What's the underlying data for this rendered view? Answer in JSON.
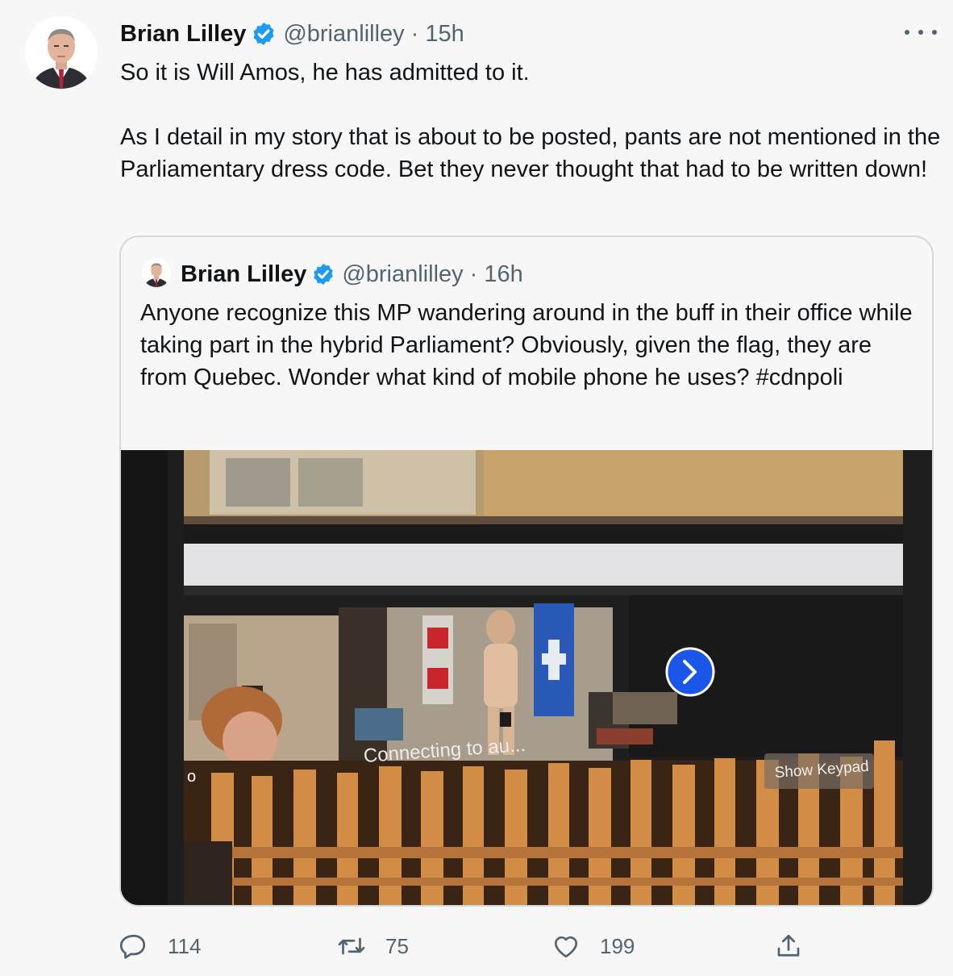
{
  "tweet": {
    "author_name": "Brian Lilley",
    "handle": "@brianlilley",
    "separator": "·",
    "time": "15h",
    "text": "So it is Will Amos, he has admitted to it.\n\nAs I detail in my story that is about to be posted, pants are not mentioned in the Parliamentary dress code. Bet they never thought that had to be written down!"
  },
  "quoted_tweet": {
    "author_name": "Brian Lilley",
    "handle": "@brianlilley",
    "separator": "·",
    "time": "16h",
    "text": "Anyone recognize this MP wandering around in the buff in their office while taking part in the hybrid Parliament? Obviously, given the flag, they are from Quebec. Wonder what kind of mobile phone he uses? #cdnpoli",
    "media": {
      "overlay_connecting": "Connecting to au...",
      "overlay_keypad": "Show Keypad",
      "overlay_edge_letter": "o"
    }
  },
  "actions": {
    "reply_count": "114",
    "retweet_count": "75",
    "like_count": "199"
  },
  "colors": {
    "background": "#f7f7f7",
    "text": "#0f1419",
    "secondary": "#536471",
    "verified": "#1d9bf0",
    "border": "#cfd9de"
  }
}
